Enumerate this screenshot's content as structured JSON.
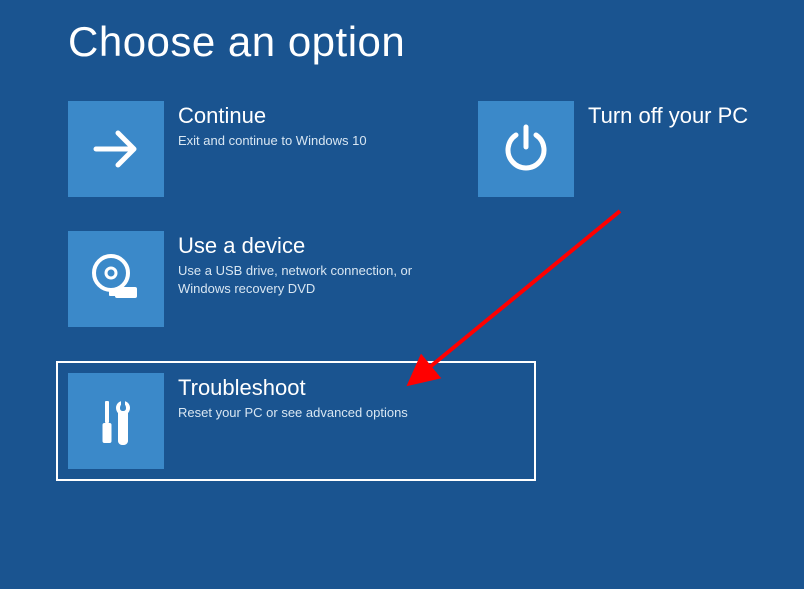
{
  "page": {
    "title": "Choose an option"
  },
  "tiles": {
    "continue": {
      "title": "Continue",
      "desc": "Exit and continue to Windows 10"
    },
    "turnoff": {
      "title": "Turn off your PC",
      "desc": ""
    },
    "usedevice": {
      "title": "Use a device",
      "desc": "Use a USB drive, network connection, or Windows recovery DVD"
    },
    "troubleshoot": {
      "title": "Troubleshoot",
      "desc": "Reset your PC or see advanced options"
    }
  },
  "colors": {
    "background": "#1a5490",
    "tile": "#3b89c9",
    "text": "#ffffff",
    "desc": "#d8e6f2",
    "arrow": "#ff0000"
  }
}
